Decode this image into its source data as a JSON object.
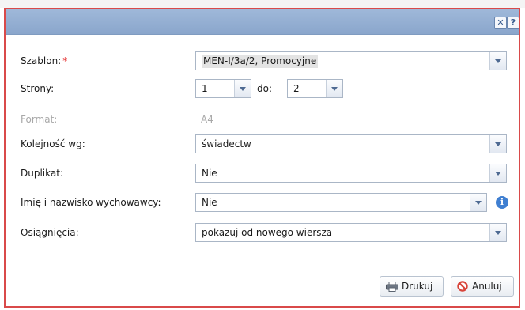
{
  "title_buttons": {
    "close": "✕",
    "help": "?"
  },
  "form": {
    "szablon": {
      "label": "Szablon:",
      "required_mark": "*",
      "value": "MEN-I/3a/2, Promocyjne"
    },
    "strony": {
      "label": "Strony:",
      "from_value": "1",
      "to_label": "do:",
      "to_value": "2"
    },
    "format": {
      "label": "Format:",
      "value": "A4"
    },
    "kolejnosc": {
      "label": "Kolejność wg:",
      "value": "świadectw"
    },
    "duplikat": {
      "label": "Duplikat:",
      "value": "Nie"
    },
    "wychowawca": {
      "label": "Imię i nazwisko wychowawcy:",
      "value": "Nie",
      "info_icon": "i"
    },
    "osiagniecia": {
      "label": "Osiągnięcia:",
      "value": "pokazuj od nowego wiersza"
    }
  },
  "buttons": {
    "print": "Drukuj",
    "cancel": "Anuluj"
  },
  "icons": {
    "print": "printer-icon",
    "cancel": "cancel-icon",
    "info": "info-icon",
    "close": "close-icon",
    "help": "help-icon"
  },
  "colors": {
    "titlebar": "#8aa6cc",
    "dialog_border": "#d94a4a",
    "required": "#e21b1b",
    "info": "#3f7fd1"
  }
}
